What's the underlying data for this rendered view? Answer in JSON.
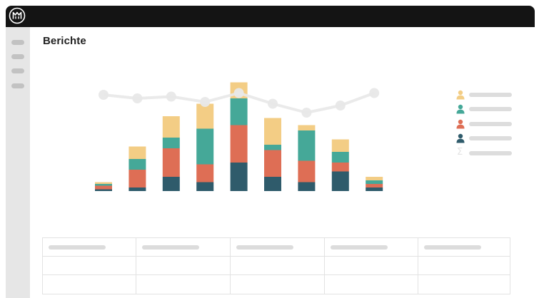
{
  "page": {
    "title": "Berichte"
  },
  "colors": {
    "titlebar": "#141414",
    "sidebar": "#e6e6e6",
    "yellow": "#f3cd85",
    "teal": "#45a898",
    "coral": "#de6e55",
    "slate": "#2f5b6b",
    "line": "#e8e8e8"
  },
  "logo": {
    "icon": "app-logo-icon"
  },
  "sidebar": {
    "items": [
      {
        "icon": "menu-item-placeholder"
      },
      {
        "icon": "menu-item-placeholder"
      },
      {
        "icon": "menu-item-placeholder"
      },
      {
        "icon": "menu-item-placeholder"
      }
    ]
  },
  "legend": {
    "items": [
      {
        "icon": "user-icon",
        "color": "#f3cd85"
      },
      {
        "icon": "user-icon",
        "color": "#45a898"
      },
      {
        "icon": "user-icon",
        "color": "#de6e55"
      },
      {
        "icon": "user-icon",
        "color": "#2f5b6b"
      },
      {
        "icon": "sigma-icon",
        "color": "#e3e3e3",
        "symbol": "Σ"
      }
    ]
  },
  "chart_data": {
    "type": "bar",
    "stacked": true,
    "categories": [
      "",
      "",
      "",
      "",
      "",
      "",
      "",
      "",
      ""
    ],
    "series": [
      {
        "values": [
          0.5,
          1.0,
          4.0,
          2.5,
          8.0,
          4.0,
          2.5,
          5.5,
          1.0
        ],
        "color": "#2f5b6b"
      },
      {
        "values": [
          1.0,
          5.0,
          8.0,
          5.0,
          10.5,
          7.5,
          6.0,
          2.5,
          1.0
        ],
        "color": "#de6e55"
      },
      {
        "values": [
          0.5,
          3.0,
          3.0,
          10.0,
          7.5,
          1.5,
          8.5,
          3.0,
          1.0
        ],
        "color": "#45a898"
      },
      {
        "values": [
          0.5,
          3.5,
          6.0,
          7.0,
          4.5,
          7.5,
          1.5,
          3.5,
          1.0
        ],
        "color": "#f3cd85"
      }
    ],
    "line": {
      "values": [
        27.0,
        26.0,
        26.5,
        25.0,
        27.5,
        24.5,
        22.0,
        24.0,
        27.5
      ],
      "color": "#e8e8e8"
    },
    "ylim": [
      0,
      36
    ],
    "grid": false,
    "legend_position": "right"
  },
  "table": {
    "rows": 3,
    "columns": 5
  }
}
